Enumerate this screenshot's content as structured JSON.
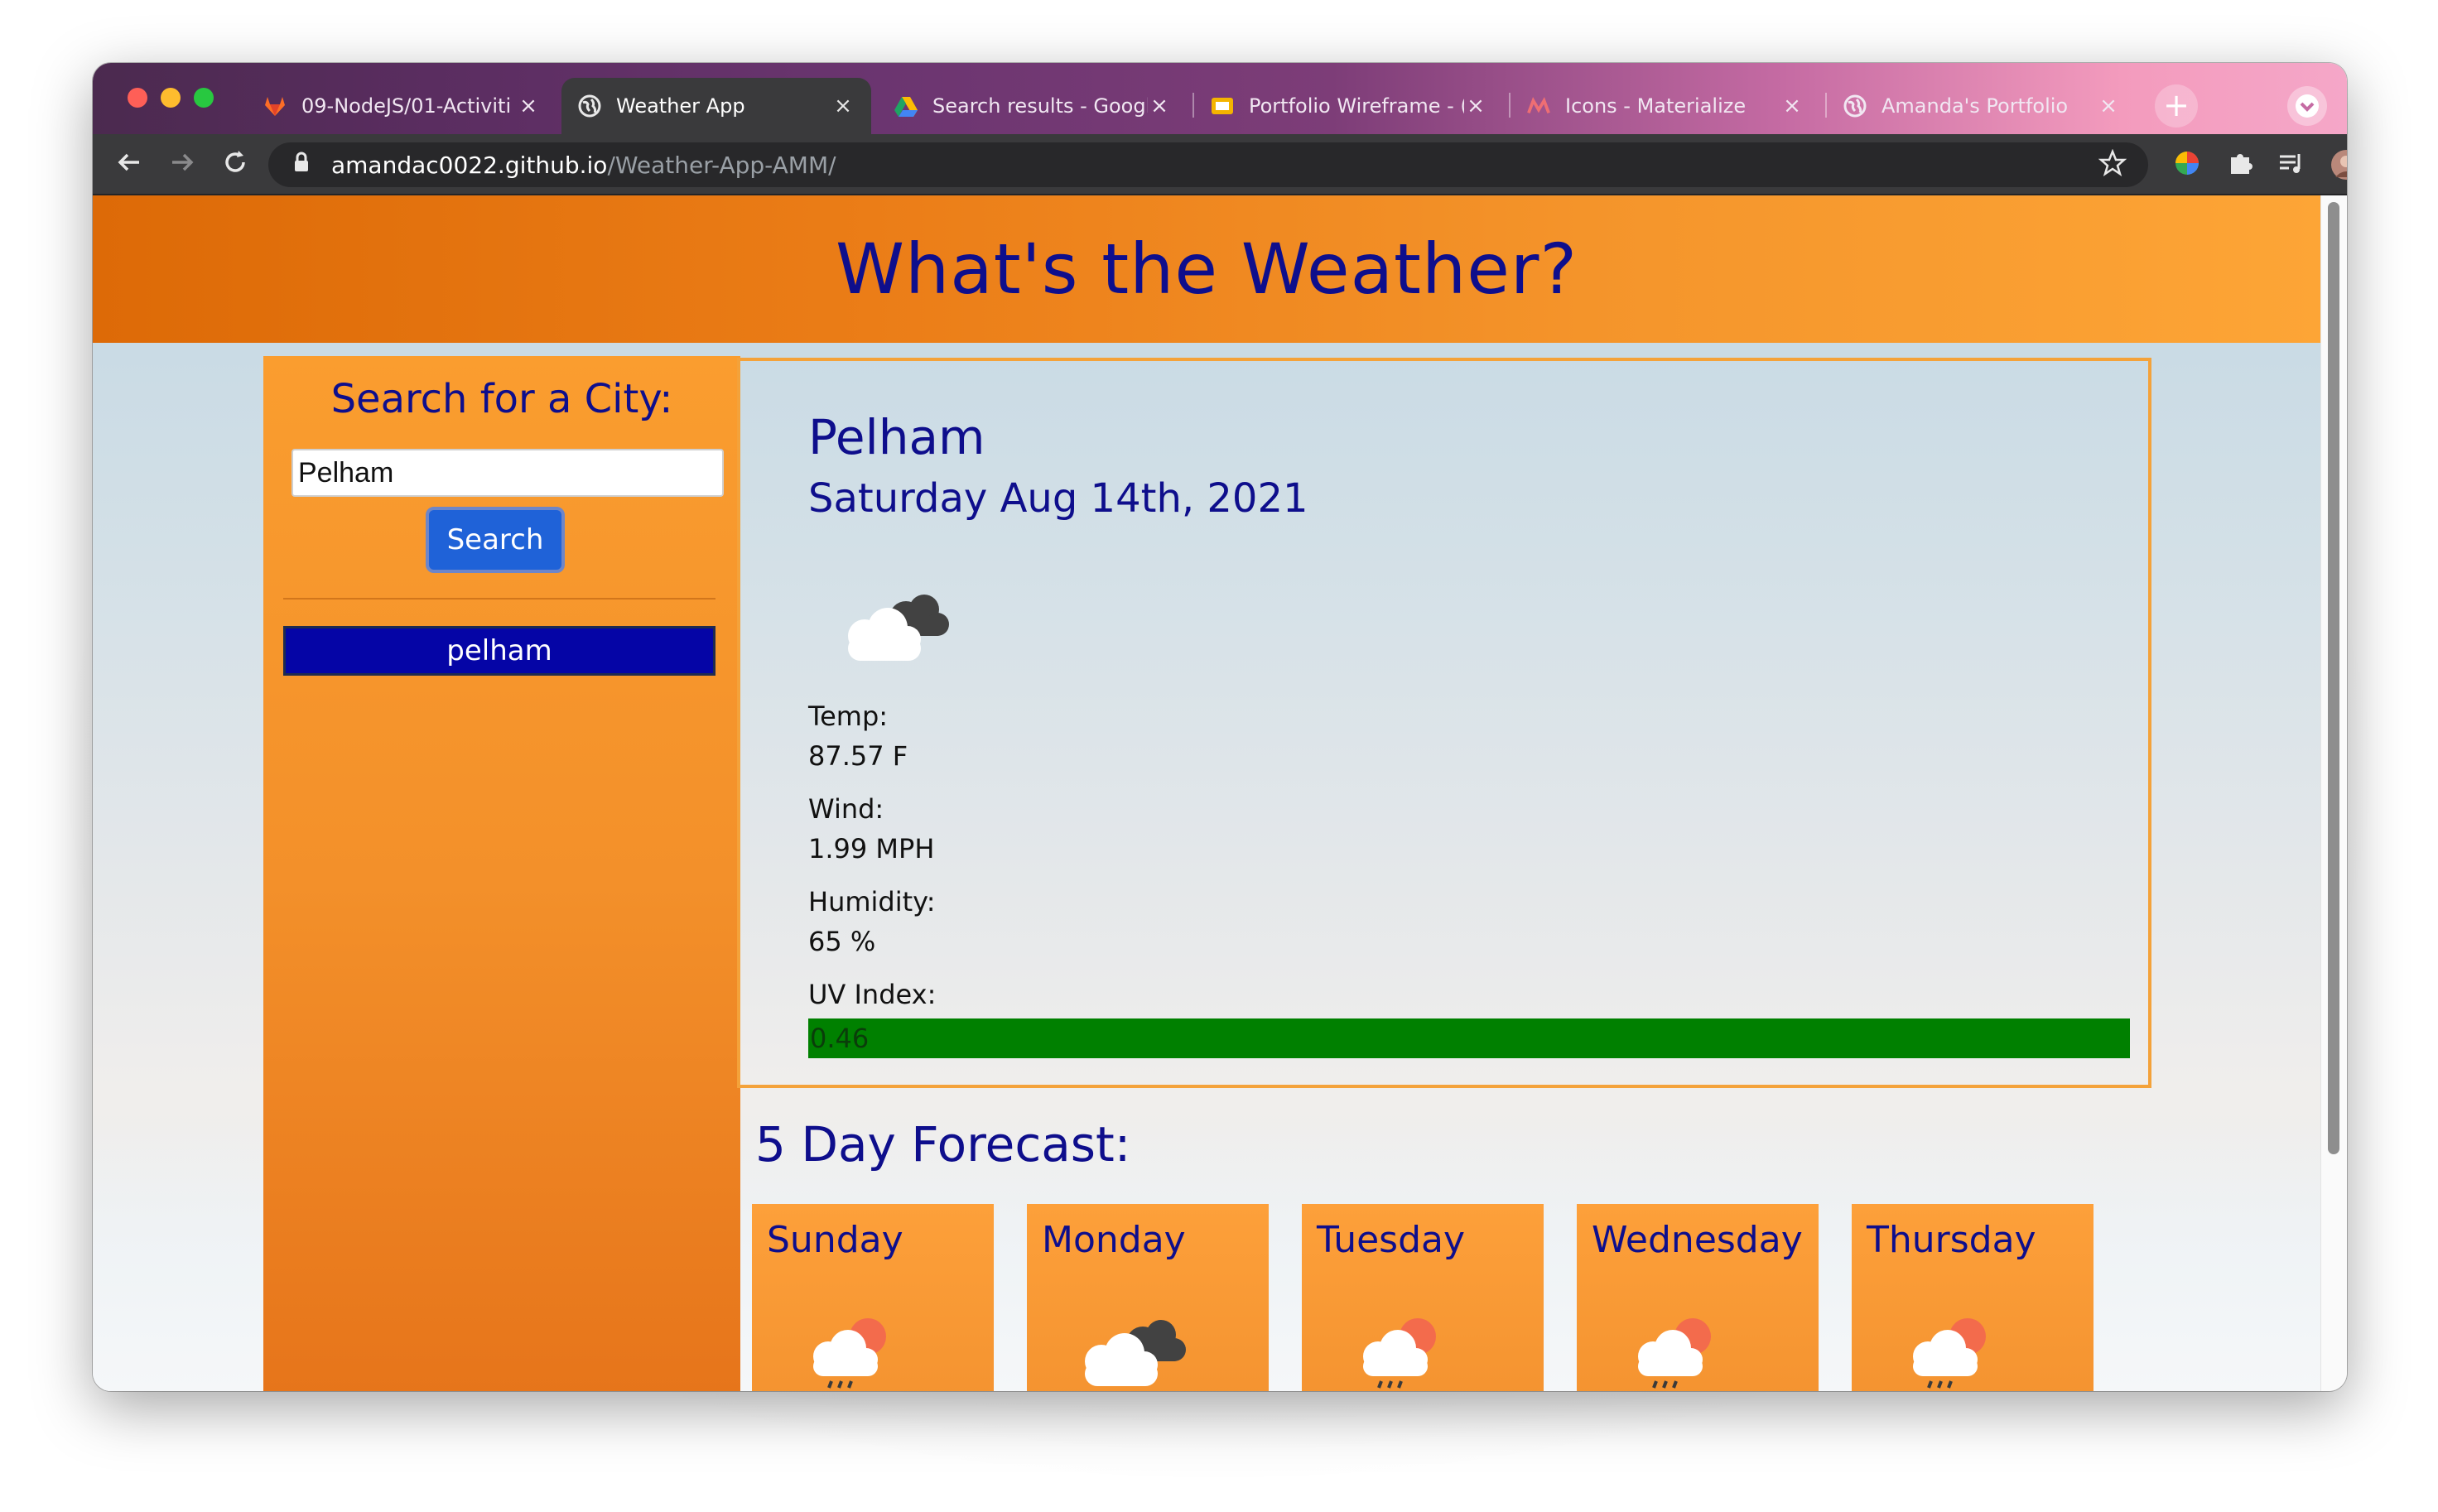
{
  "browser": {
    "tabs": [
      {
        "title": "09-NodeJS/01-Activiti",
        "icon": "gitlab-icon",
        "active": false
      },
      {
        "title": "Weather App",
        "icon": "globe-icon",
        "active": true
      },
      {
        "title": "Search results - Googl",
        "icon": "google-drive-icon",
        "active": false
      },
      {
        "title": "Portfolio Wireframe - (",
        "icon": "google-slides-icon",
        "active": false
      },
      {
        "title": "Icons - Materialize",
        "icon": "materialize-icon",
        "active": false
      },
      {
        "title": "Amanda's Portfolio",
        "icon": "globe-icon",
        "active": false
      }
    ],
    "close_glyph": "×",
    "new_tab_glyph": "+",
    "url_host": "amandac0022.github.io",
    "url_path": "/Weather-App-AMM/"
  },
  "header": {
    "title": "What's the Weather?"
  },
  "sidebar": {
    "heading": "Search for a City:",
    "input_value": "Pelham",
    "search_label": "Search",
    "history": [
      "pelham"
    ]
  },
  "current": {
    "city": "Pelham",
    "date": "Saturday Aug 14th, 2021",
    "icon": "cloudy-icon",
    "temp_label": "Temp:",
    "temp_value": "87.57 F",
    "wind_label": "Wind:",
    "wind_value": "1.99 MPH",
    "humidity_label": "Humidity:",
    "humidity_value": "65 %",
    "uv_label": "UV Index:",
    "uv_value": "0.46",
    "uv_color": "#008000"
  },
  "forecast": {
    "title": "5 Day Forecast:",
    "days": [
      {
        "day": "Sunday",
        "icon": "rain-sun-icon"
      },
      {
        "day": "Monday",
        "icon": "cloudy-icon"
      },
      {
        "day": "Tuesday",
        "icon": "rain-sun-icon"
      },
      {
        "day": "Wednesday",
        "icon": "rain-sun-icon"
      },
      {
        "day": "Thursday",
        "icon": "rain-sun-icon"
      }
    ]
  },
  "colors": {
    "accent_orange": "#f5962c",
    "title_navy": "#0e0e8c",
    "history_blue": "#0505a6",
    "button_blue": "#1f62d8"
  }
}
